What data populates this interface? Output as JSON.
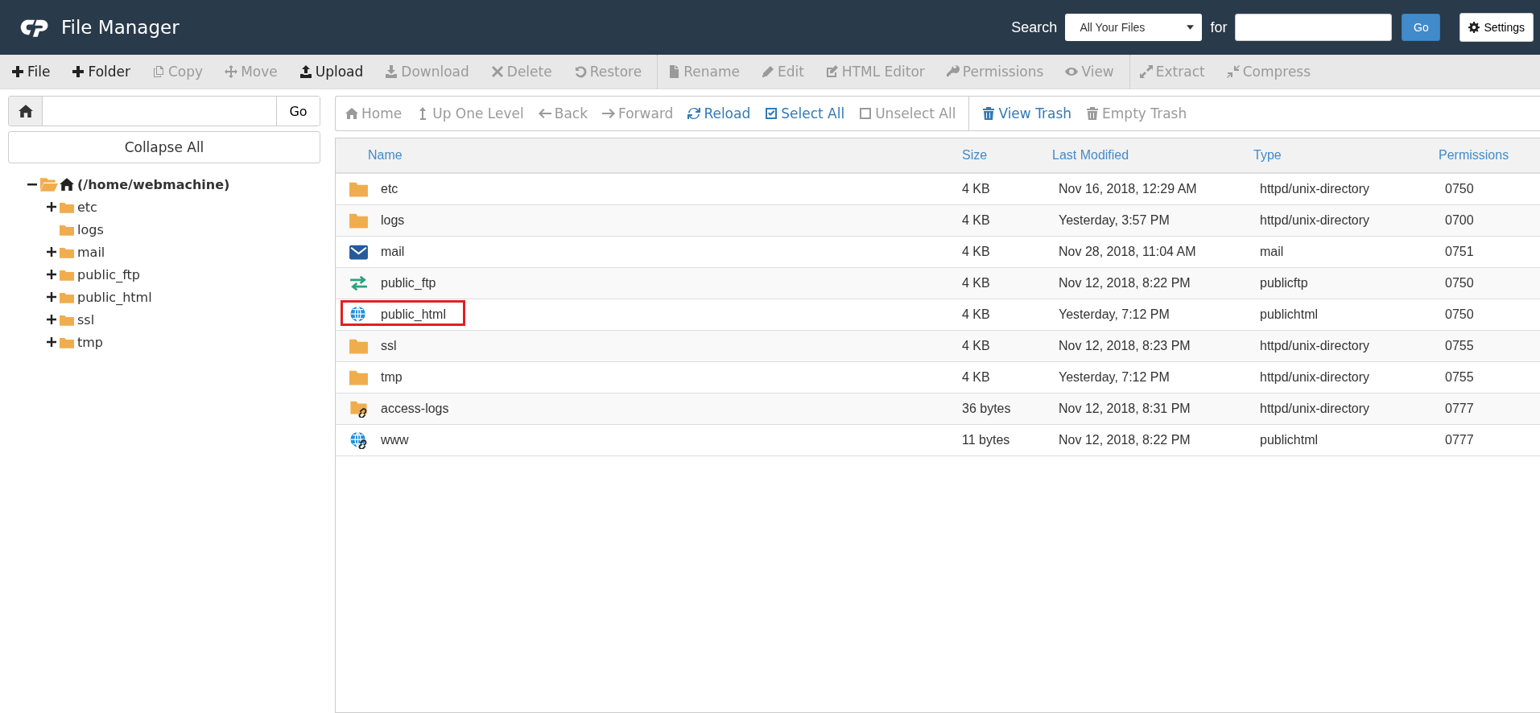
{
  "header": {
    "title": "File Manager",
    "search_label": "Search",
    "search_scope": "All Your Files",
    "for_label": "for",
    "go_button": "Go",
    "settings_button": "Settings"
  },
  "toolbar": [
    {
      "label": "File",
      "disabled": false
    },
    {
      "label": "Folder",
      "disabled": false
    },
    {
      "label": "Copy",
      "disabled": true
    },
    {
      "label": "Move",
      "disabled": true
    },
    {
      "label": "Upload",
      "disabled": false
    },
    {
      "label": "Download",
      "disabled": true
    },
    {
      "label": "Delete",
      "disabled": true
    },
    {
      "label": "Restore",
      "disabled": true
    },
    {
      "label": "Rename",
      "disabled": true
    },
    {
      "label": "Edit",
      "disabled": true
    },
    {
      "label": "HTML Editor",
      "disabled": true
    },
    {
      "label": "Permissions",
      "disabled": true
    },
    {
      "label": "View",
      "disabled": true
    },
    {
      "label": "Extract",
      "disabled": true
    },
    {
      "label": "Compress",
      "disabled": true
    }
  ],
  "path_bar": {
    "go_button": "Go"
  },
  "collapse_button": "Collapse All",
  "tree": {
    "label": "(/home/webmachine)",
    "expanded": true,
    "children": [
      {
        "label": "etc",
        "expandable": true
      },
      {
        "label": "logs",
        "expandable": false
      },
      {
        "label": "mail",
        "expandable": true
      },
      {
        "label": "public_ftp",
        "expandable": true
      },
      {
        "label": "public_html",
        "expandable": true
      },
      {
        "label": "ssl",
        "expandable": true
      },
      {
        "label": "tmp",
        "expandable": true
      }
    ]
  },
  "nav": [
    {
      "label": "Home",
      "disabled": true
    },
    {
      "label": "Up One Level",
      "disabled": true
    },
    {
      "label": "Back",
      "disabled": true
    },
    {
      "label": "Forward",
      "disabled": true
    },
    {
      "label": "Reload",
      "disabled": false
    },
    {
      "label": "Select All",
      "disabled": false
    },
    {
      "label": "Unselect All",
      "disabled": true
    },
    {
      "label": "View Trash",
      "disabled": false
    },
    {
      "label": "Empty Trash",
      "disabled": true
    }
  ],
  "table": {
    "columns": [
      "Name",
      "Size",
      "Last Modified",
      "Type",
      "Permissions"
    ],
    "rows": [
      {
        "kind": "folder",
        "name": "etc",
        "size": "4 KB",
        "modified": "Nov 16, 2018, 12:29 AM",
        "type": "httpd/unix-directory",
        "permissions": "0750",
        "annotated": false
      },
      {
        "kind": "folder",
        "name": "logs",
        "size": "4 KB",
        "modified": "Yesterday, 3:57 PM",
        "type": "httpd/unix-directory",
        "permissions": "0700",
        "annotated": false
      },
      {
        "kind": "mail",
        "name": "mail",
        "size": "4 KB",
        "modified": "Nov 28, 2018, 11:04 AM",
        "type": "mail",
        "permissions": "0751",
        "annotated": false
      },
      {
        "kind": "ftp",
        "name": "public_ftp",
        "size": "4 KB",
        "modified": "Nov 12, 2018, 8:22 PM",
        "type": "publicftp",
        "permissions": "0750",
        "annotated": false
      },
      {
        "kind": "web",
        "name": "public_html",
        "size": "4 KB",
        "modified": "Yesterday, 7:12 PM",
        "type": "publichtml",
        "permissions": "0750",
        "annotated": true
      },
      {
        "kind": "folder",
        "name": "ssl",
        "size": "4 KB",
        "modified": "Nov 12, 2018, 8:23 PM",
        "type": "httpd/unix-directory",
        "permissions": "0755",
        "annotated": false
      },
      {
        "kind": "folder",
        "name": "tmp",
        "size": "4 KB",
        "modified": "Yesterday, 7:12 PM",
        "type": "httpd/unix-directory",
        "permissions": "0755",
        "annotated": false
      },
      {
        "kind": "folder-link",
        "name": "access-logs",
        "size": "36 bytes",
        "modified": "Nov 12, 2018, 8:31 PM",
        "type": "httpd/unix-directory",
        "permissions": "0777",
        "annotated": false
      },
      {
        "kind": "web-link",
        "name": "www",
        "size": "11 bytes",
        "modified": "Nov 12, 2018, 8:22 PM",
        "type": "publichtml",
        "permissions": "0777",
        "annotated": false
      }
    ]
  }
}
